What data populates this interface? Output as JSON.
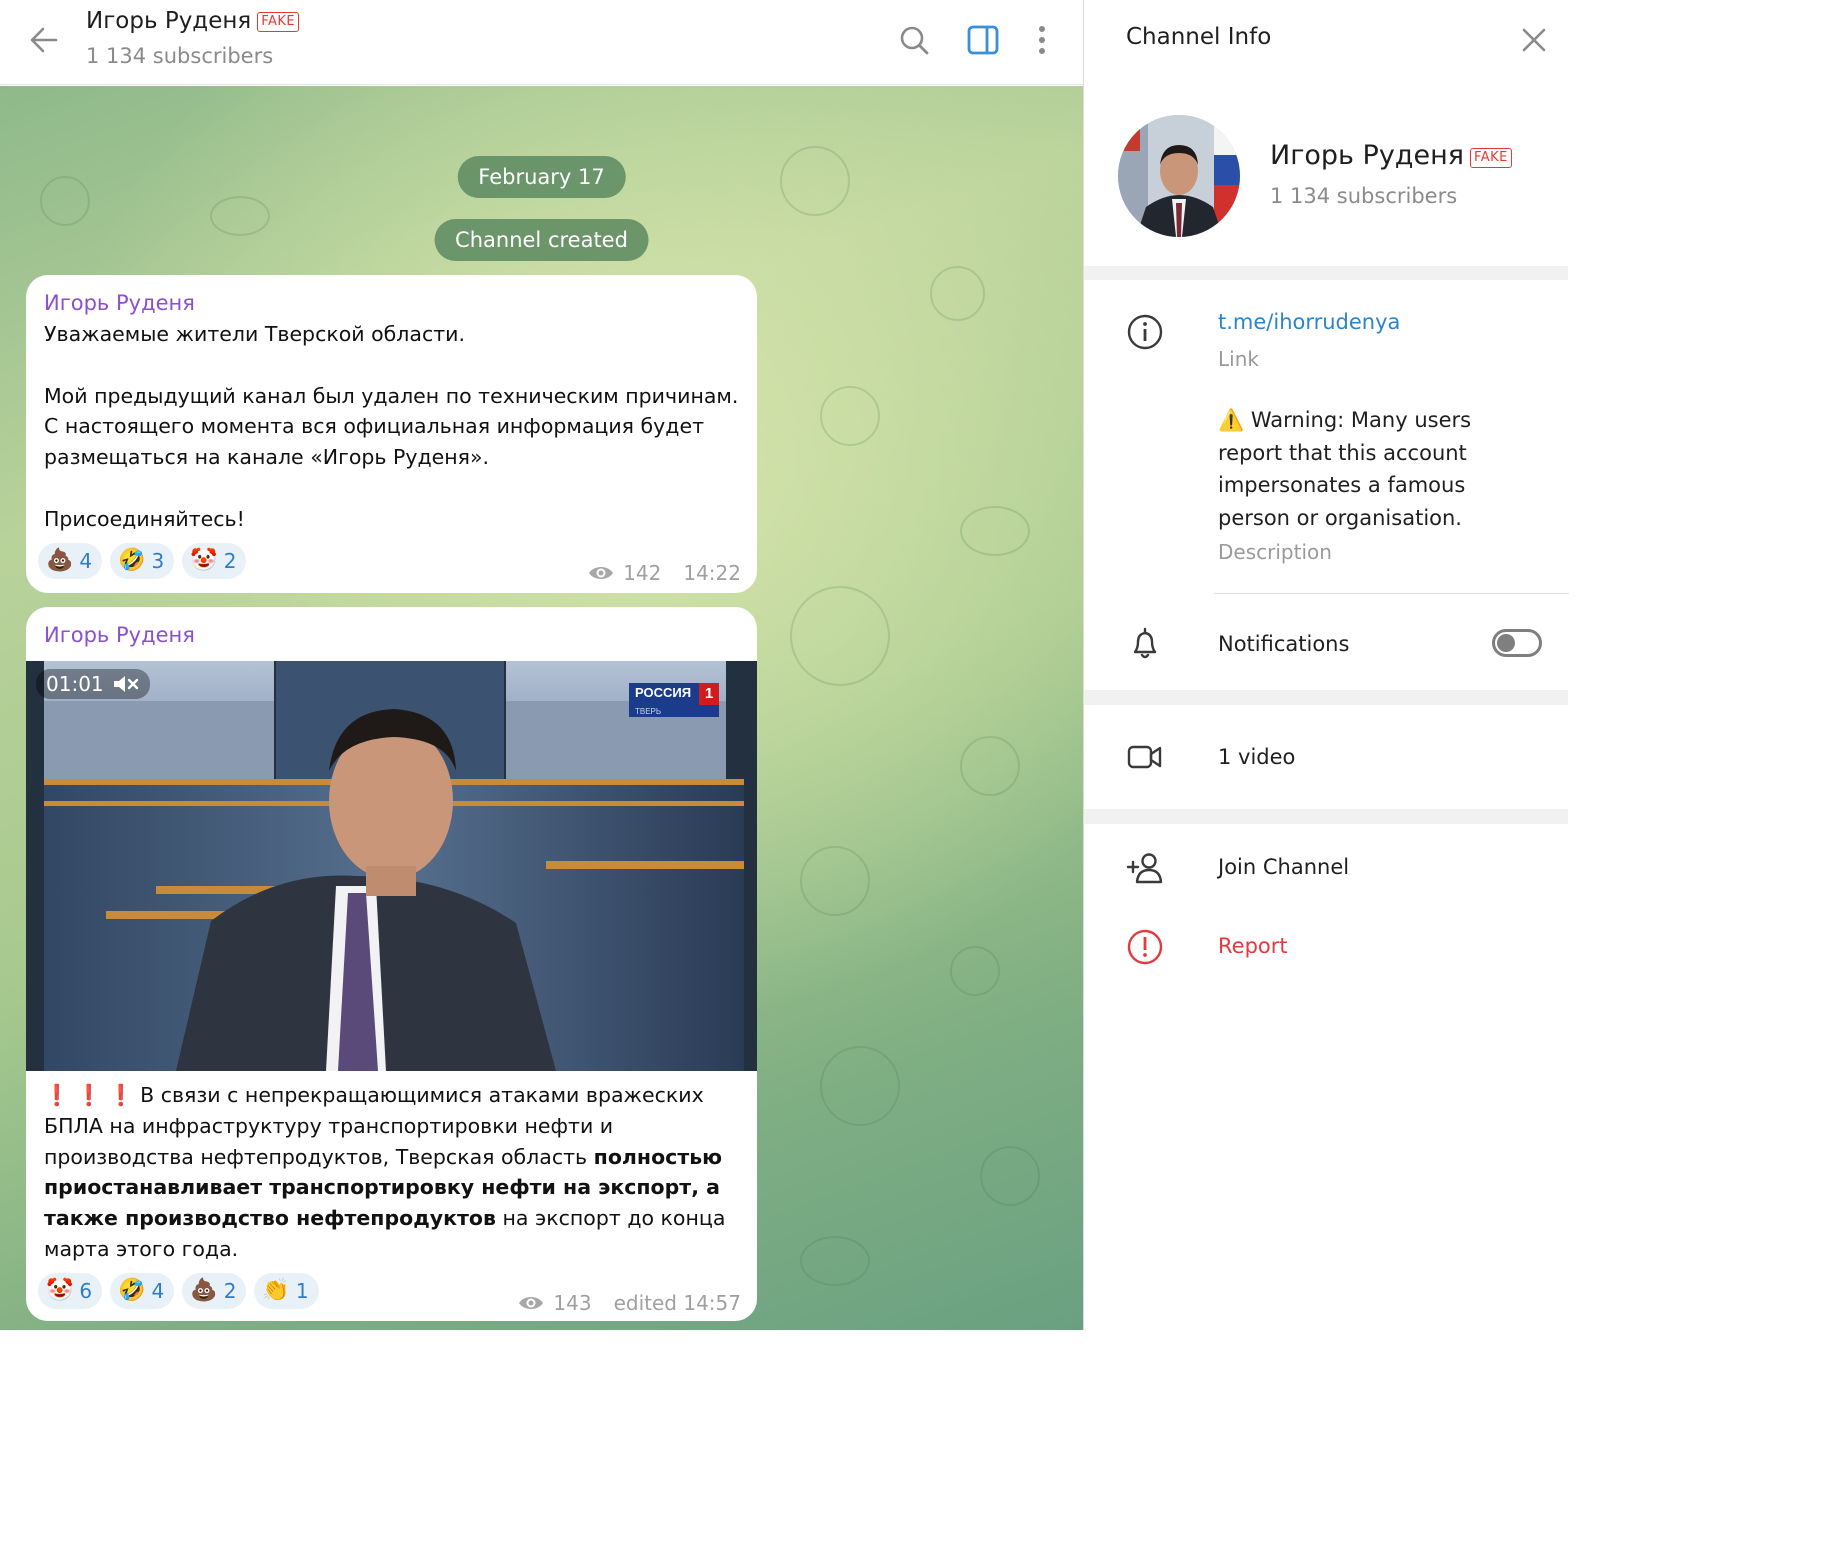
{
  "header": {
    "title": "Игорь Руденя",
    "fake_label": "FAKE",
    "subscribers": "1 134 subscribers"
  },
  "chat": {
    "date_pill": "February 17",
    "service_message": "Channel created",
    "messages": [
      {
        "sender": "Игорь Руденя",
        "text": "Уважаемые жители Тверской области.\n\nМой предыдущий канал был удален по техническим причинам. С настоящего момента вся официальная информация будет размещаться на канале «Игорь Руденя».\n\nПрисоединяйтесь!",
        "reactions": [
          {
            "emoji": "💩",
            "count": "4"
          },
          {
            "emoji": "🤣",
            "count": "3"
          },
          {
            "emoji": "🤡",
            "count": "2"
          }
        ],
        "views": "142",
        "time": "14:22"
      },
      {
        "sender": "Игорь Руденя",
        "video_duration": "01:01",
        "video_overlay_logo": "РОССИЯ",
        "video_overlay_logo_number": "1",
        "video_overlay_logo_city": "ТВЕРЬ",
        "text_prefix": "❗ ❗ ❗ В связи с непрекращающимися атаками вражеских БПЛА на инфраструктуру транспортировки нефти и производства нефтепродуктов, Тверская область ",
        "text_bold1": "полностью приостанавливает транспортировку нефти на экспорт, а также производство нефтепродуктов",
        "text_suffix": " на экспорт до конца марта этого года.",
        "reactions": [
          {
            "emoji": "🤡",
            "count": "6"
          },
          {
            "emoji": "🤣",
            "count": "4"
          },
          {
            "emoji": "💩",
            "count": "2"
          },
          {
            "emoji": "👏",
            "count": "1"
          }
        ],
        "views": "143",
        "time": "edited 14:57"
      }
    ]
  },
  "info_panel": {
    "title": "Channel Info",
    "name": "Игорь Руденя",
    "fake_label": "FAKE",
    "subscribers": "1 134 subscribers",
    "link": "t.me/ihorrudenya",
    "link_label": "Link",
    "warning_emoji": "⚠️",
    "warning": "Warning: Many users report that this account impersonates a famous person or organisation.",
    "description_label": "Description",
    "notifications_label": "Notifications",
    "notifications_on": false,
    "video_count": "1 video",
    "join_label": "Join Channel",
    "report_label": "Report"
  },
  "colors": {
    "accent": "#2a85c9",
    "sender": "#8a4fd3",
    "report": "#e5393f",
    "fake": "#e53935"
  }
}
